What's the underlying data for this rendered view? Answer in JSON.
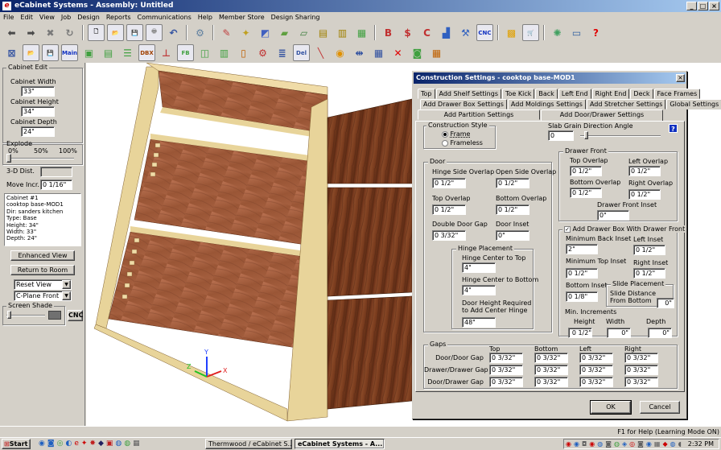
{
  "app": {
    "title": "eCabinet Systems - Assembly: Untitled",
    "logo_glyph": "e"
  },
  "window_controls": {
    "minimize": "_",
    "maximize": "□",
    "close": "×"
  },
  "menu": [
    "File",
    "Edit",
    "View",
    "Job",
    "Design",
    "Reports",
    "Communications",
    "Help",
    "Member Store",
    "Design Sharing"
  ],
  "toolbar1": [
    {
      "name": "back-icon",
      "glyph": "⬅",
      "color": "#4a4a4a"
    },
    {
      "name": "forward-icon",
      "glyph": "➡",
      "color": "#4a4a4a"
    },
    {
      "name": "stop-icon",
      "glyph": "✖",
      "color": "#7a7a7a"
    },
    {
      "name": "refresh-icon",
      "glyph": "↻",
      "color": "#7a7a7a"
    },
    {
      "name": "new-icon",
      "glyph": "🗋",
      "color": "#ffffff"
    },
    {
      "name": "open-icon",
      "glyph": "📂",
      "color": "#e8c060"
    },
    {
      "name": "save-icon",
      "glyph": "💾",
      "color": "#303060"
    },
    {
      "name": "print-icon",
      "glyph": "🖶",
      "color": "#909090"
    },
    {
      "name": "undo-icon",
      "glyph": "↶",
      "color": "#3050a0"
    },
    {
      "name": "settings-icon",
      "glyph": "⚙",
      "color": "#6080a0"
    },
    {
      "name": "paint-icon",
      "glyph": "✎",
      "color": "#c04040"
    },
    {
      "name": "design-icon",
      "glyph": "✦",
      "color": "#c0a020"
    },
    {
      "name": "draw-icon",
      "glyph": "◩",
      "color": "#4060c0"
    },
    {
      "name": "panel-icon",
      "glyph": "▰",
      "color": "#60a040"
    },
    {
      "name": "sheet-icon",
      "glyph": "▱",
      "color": "#408040"
    },
    {
      "name": "cabinet-icon",
      "glyph": "▤",
      "color": "#a08000"
    },
    {
      "name": "library-icon",
      "glyph": "▥",
      "color": "#a08000"
    },
    {
      "name": "catalog-icon",
      "glyph": "▦",
      "color": "#40a040"
    },
    {
      "name": "report-b-icon",
      "glyph": "B",
      "color": "#c03030"
    },
    {
      "name": "report-dollar-icon",
      "glyph": "$",
      "color": "#c03030"
    },
    {
      "name": "report-c-icon",
      "glyph": "C",
      "color": "#c03030"
    },
    {
      "name": "chart-icon",
      "glyph": "▟",
      "color": "#3060c0"
    },
    {
      "name": "machine-icon",
      "glyph": "⚒",
      "color": "#3060c0"
    },
    {
      "name": "cnc-icon",
      "glyph": "CNC",
      "color": "#1030c0"
    },
    {
      "name": "layout-icon",
      "glyph": "▩",
      "color": "#e0a000"
    },
    {
      "name": "cart-icon",
      "glyph": "🛒",
      "color": "#3050a0"
    },
    {
      "name": "community-icon",
      "glyph": "✺",
      "color": "#40a060"
    },
    {
      "name": "monitor-icon",
      "glyph": "▭",
      "color": "#3060a0"
    },
    {
      "name": "help-icon",
      "glyph": "?",
      "color": "#e00000"
    }
  ],
  "toolbar2": [
    {
      "name": "cabinet-edit-icon",
      "glyph": "⊠",
      "color": "#3050a0"
    },
    {
      "name": "open-folder-icon",
      "glyph": "📂",
      "color": "#e8c060"
    },
    {
      "name": "save-disk-icon",
      "glyph": "💾",
      "color": "#303060"
    },
    {
      "name": "main-icon",
      "glyph": "Main",
      "color": "#1030c0"
    },
    {
      "name": "box-icon",
      "glyph": "▣",
      "color": "#40a040"
    },
    {
      "name": "face-icon",
      "glyph": "▤",
      "color": "#40a040"
    },
    {
      "name": "drawer-icon",
      "glyph": "☰",
      "color": "#40a040"
    },
    {
      "name": "dbx-icon",
      "glyph": "DBX",
      "color": "#a04000"
    },
    {
      "name": "shelf-icon",
      "glyph": "⊥",
      "color": "#c04040"
    },
    {
      "name": "fb-icon",
      "glyph": "FB",
      "color": "#40a040"
    },
    {
      "name": "toe-icon",
      "glyph": "◫",
      "color": "#40a040"
    },
    {
      "name": "partition-icon",
      "glyph": "▥",
      "color": "#40a040"
    },
    {
      "name": "door-icon",
      "glyph": "▯",
      "color": "#c06000"
    },
    {
      "name": "gear-icon",
      "glyph": "⚙",
      "color": "#c03030"
    },
    {
      "name": "list-icon",
      "glyph": "≣",
      "color": "#3050a0"
    },
    {
      "name": "delete-item-icon",
      "glyph": "Del",
      "color": "#3050a0"
    },
    {
      "name": "pencil-icon",
      "glyph": "╲",
      "color": "#c03030"
    },
    {
      "name": "part-icon",
      "glyph": "◉",
      "color": "#e09000"
    },
    {
      "name": "divider-icon",
      "glyph": "⇹",
      "color": "#3050a0"
    },
    {
      "name": "grid-icon",
      "glyph": "▦",
      "color": "#3050a0"
    },
    {
      "name": "remove-icon",
      "glyph": "✕",
      "color": "#e00000"
    },
    {
      "name": "camera-icon",
      "glyph": "◙",
      "color": "#40a040"
    },
    {
      "name": "calendar-icon",
      "glyph": "▦",
      "color": "#c06000"
    }
  ],
  "left_panel": {
    "group_title": "Cabinet Edit",
    "width_label": "Cabinet Width",
    "width_value": "33\"",
    "height_label": "Cabinet Height",
    "height_value": "34\"",
    "depth_label": "Cabinet Depth",
    "depth_value": "24\"",
    "explode_label": "Explode",
    "explode_ticks": [
      "0%",
      "50%",
      "100%"
    ],
    "dist_label": "3-D Dist.",
    "move_label": "Move Incr.",
    "move_value": "0 1/16\"",
    "info_lines": [
      "Cabinet #1",
      "cooktop base-MOD1",
      "Dir: sanders kitchen",
      "Type: Base",
      "Height: 34\"",
      "Width: 33\"",
      "Depth: 24\""
    ],
    "enhanced_view": "Enhanced View",
    "return_to_room": "Return to Room",
    "view_select": "Reset View",
    "plane_select": "C-Plane Front",
    "screen_shade": "Screen Shade",
    "cnc_button": "CNC"
  },
  "dialog": {
    "title": "Construction Settings - cooktop base-MOD1",
    "close": "×",
    "tabs_row1": [
      "Top",
      "Add Shelf Settings",
      "Toe Kick",
      "Back",
      "Left End",
      "Right End",
      "Deck",
      "Face Frames"
    ],
    "tabs_row2": [
      "Add Drawer Box Settings",
      "Add Moldings Settings",
      "Add Stretcher Settings",
      "Global Settings"
    ],
    "tabs_row3": [
      "Add Partition Settings",
      "Add Door/Drawer Settings"
    ],
    "construction_style": {
      "caption": "Construction Style",
      "frame": "Frame",
      "frameless": "Frameless",
      "selected": "Frame"
    },
    "slab_grain": {
      "label": "Slab Grain Direction Angle",
      "value": "0"
    },
    "help": "?",
    "door": {
      "caption": "Door",
      "hinge_side_overlap": "Hinge Side Overlap",
      "hinge_side_overlap_value": "0 1/2\"",
      "open_side_overlap": "Open Side Overlap",
      "open_side_overlap_value": "0 1/2\"",
      "top_overlap": "Top Overlap",
      "top_overlap_value": "0 1/2\"",
      "bottom_overlap": "Bottom Overlap",
      "bottom_overlap_value": "0 1/2\"",
      "double_door_gap": "Double Door Gap",
      "double_door_gap_value": "0 3/32\"",
      "door_inset": "Door Inset",
      "door_inset_value": "0\""
    },
    "hinge": {
      "caption": "Hinge Placement",
      "center_top": "Hinge Center to Top",
      "center_top_value": "4\"",
      "center_bottom": "Hinge Center to Bottom",
      "center_bottom_value": "4\"",
      "door_height_l1": "Door Height Required",
      "door_height_l2": "to Add Center Hinge",
      "door_height_value": "48\""
    },
    "drawer_front": {
      "caption": "Drawer Front",
      "top_overlap": "Top Overlap",
      "top_overlap_value": "0 1/2\"",
      "left_overlap": "Left Overlap",
      "left_overlap_value": "0 1/2\"",
      "bottom_overlap": "Bottom Overlap",
      "bottom_overlap_value": "0 1/2\"",
      "right_overlap": "Right Overlap",
      "right_overlap_value": "0 1/2\"",
      "inset": "Drawer Front Inset",
      "inset_value": "0\""
    },
    "drawer_box": {
      "caption": "Add Drawer Box With Drawer Front",
      "checked": "✓",
      "min_back_inset": "Minimum Back Inset",
      "min_back_inset_value": "2\"",
      "left_inset": "Left Inset",
      "left_inset_value": "0 1/2\"",
      "min_top_inset": "Minimum Top Inset",
      "min_top_inset_value": "0 1/2\"",
      "right_inset": "Right Inset",
      "right_inset_value": "0 1/2\"",
      "bottom_inset": "Bottom Inset",
      "bottom_inset_value": "0 1/8\"",
      "slide_caption": "Slide Placement",
      "slide_distance_l1": "Slide Distance",
      "slide_distance_l2": "From Bottom",
      "slide_distance_value": "0\"",
      "min_increments": "Min. Increments",
      "height": "Height",
      "height_value": "0 1/2\"",
      "width": "Width",
      "width_value": "0\"",
      "depth": "Depth",
      "depth_value": "0\""
    },
    "gaps": {
      "caption": "Gaps",
      "columns": [
        "Top",
        "Bottom",
        "Left",
        "Right"
      ],
      "rows": [
        {
          "label": "Door/Door Gap",
          "values": [
            "0 3/32\"",
            "0 3/32\"",
            "0 3/32\"",
            "0 3/32\""
          ]
        },
        {
          "label": "Drawer/Drawer Gap",
          "values": [
            "0 3/32\"",
            "0 3/32\"",
            "0 3/32\"",
            "0 3/32\""
          ]
        },
        {
          "label": "Door/Drawer Gap",
          "values": [
            "0 3/32\"",
            "0 3/32\"",
            "0 3/32\"",
            "0 3/32\""
          ]
        }
      ]
    },
    "ok": "OK",
    "cancel": "Cancel"
  },
  "status": "F1 for Help (Learning Mode ON)",
  "taskbar": {
    "start": "Start",
    "tasks": [
      "Thermwood / eCabinet S...",
      "eCabinet Systems - A..."
    ],
    "clock": "2:32 PM"
  },
  "axes": {
    "x": "X",
    "y": "Y",
    "z": "Z"
  }
}
